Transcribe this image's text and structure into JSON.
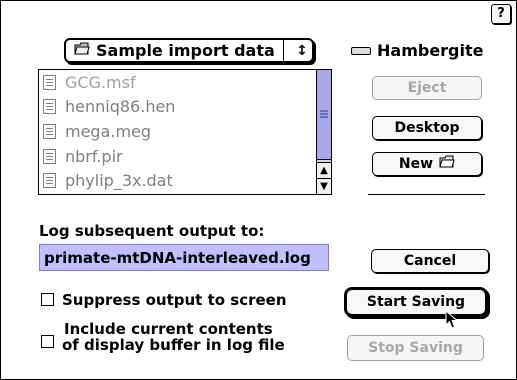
{
  "help_button": "?",
  "folder_popup": {
    "label": "Sample import data",
    "arrows": "↕"
  },
  "volume": {
    "name": "Hambergite"
  },
  "files": [
    {
      "name": "GCG.msf"
    },
    {
      "name": "henniq86.hen"
    },
    {
      "name": "mega.meg"
    },
    {
      "name": "nbrf.pir"
    },
    {
      "name": "phylip_3x.dat"
    }
  ],
  "buttons": {
    "eject": "Eject",
    "desktop": "Desktop",
    "new": "New",
    "cancel": "Cancel",
    "start_saving": "Start Saving",
    "stop_saving": "Stop Saving"
  },
  "log": {
    "label": "Log subsequent output to:",
    "filename": "primate-mtDNA-interleaved.log"
  },
  "options": {
    "suppress": "Suppress output to screen",
    "include_line1": "Include current contents",
    "include_line2": "of display buffer in log file"
  },
  "icons": {
    "folder": "folder-icon",
    "drive": "drive-icon",
    "file": "document-icon",
    "cursor": "arrow-cursor-icon"
  }
}
